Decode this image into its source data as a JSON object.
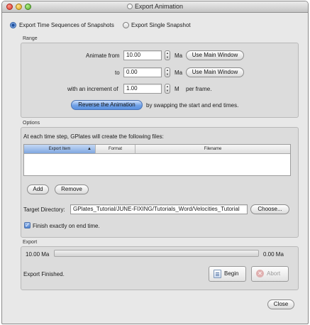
{
  "window": {
    "title": "Export Animation"
  },
  "mode": {
    "sequence_label": "Export Time Sequences of Snapshots",
    "single_label": "Export Single Snapshot",
    "selected": "sequence"
  },
  "range": {
    "group_label": "Range",
    "animate_from_label": "Animate from",
    "animate_from_value": "10.00",
    "from_unit": "Ma",
    "use_main_window_label": "Use Main Window",
    "to_label": "to",
    "to_value": "0.00",
    "to_unit": "Ma",
    "increment_label": "with an increment of",
    "increment_value": "1.00",
    "increment_unit": "M",
    "per_frame_label": "per frame.",
    "reverse_button_label": "Reverse the Animation",
    "reverse_hint": "by swapping the start and end times."
  },
  "options": {
    "group_label": "Options",
    "description": "At each time step, GPlates will create the following files:",
    "table": {
      "columns": [
        "Export Item",
        "Format",
        "Filename"
      ],
      "sort_indicator": "▲",
      "rows": []
    },
    "add_label": "Add",
    "remove_label": "Remove",
    "target_directory_label": "Target Directory:",
    "target_directory_value": "GPlates_Tutorial/JUNE-FIXING/Tutorials_Word/Velocities_Tutorial",
    "choose_label": "Choose...",
    "finish_exactly_label": "Finish exactly on end time.",
    "finish_exactly_checked": true
  },
  "export": {
    "group_label": "Export",
    "start_time_label": "10.00 Ma",
    "end_time_label": "0.00 Ma",
    "progress": 0,
    "status_text": "Export Finished.",
    "begin_label": "Begin",
    "abort_label": "Abort"
  },
  "close_label": "Close",
  "icons": {
    "window": "animation-icon",
    "begin": "document-icon",
    "abort": "stop-icon",
    "checkmark": "checkmark-icon"
  }
}
